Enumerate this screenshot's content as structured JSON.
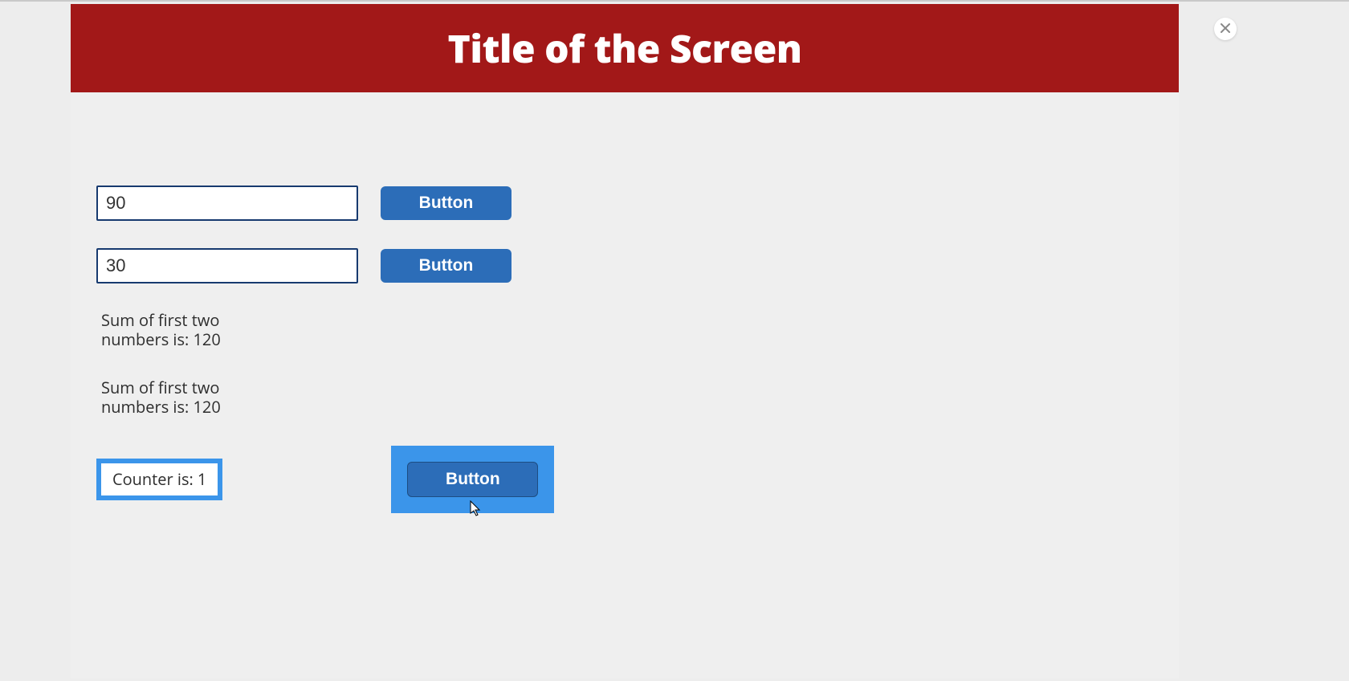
{
  "header": {
    "title": "Title of the Screen"
  },
  "inputs": {
    "first": "90",
    "second": "30"
  },
  "buttons": {
    "btn1": "Button",
    "btn2": "Button",
    "btn3": "Button"
  },
  "results": {
    "sum1": "Sum of first two numbers is: 120",
    "sum2": "Sum of first two numbers is: 120"
  },
  "counter": {
    "label": "Counter is: 1"
  }
}
